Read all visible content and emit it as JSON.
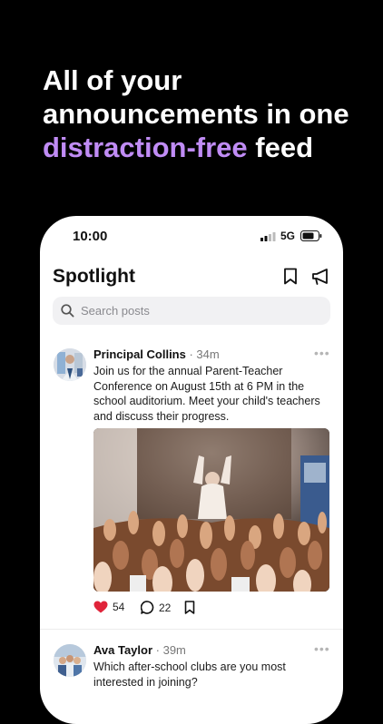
{
  "headline": {
    "line1": "All of your",
    "line2": "announcements in one",
    "accent": "distraction-free",
    "tail": " feed"
  },
  "status_bar": {
    "time": "10:00",
    "network": "5G"
  },
  "app": {
    "title": "Spotlight",
    "search_placeholder": "Search posts"
  },
  "posts": [
    {
      "author": "Principal Collins",
      "separator": " · ",
      "time": "34m",
      "body": "Join us for the annual Parent-Teacher Conference on August 15th at 6 PM in the school auditorium. Meet your child's teachers and discuss their progress.",
      "likes": "54",
      "comments": "22",
      "liked": true
    },
    {
      "author": "Ava Taylor",
      "separator": " · ",
      "time": "39m",
      "body": "Which after-school clubs are you most interested in joining?"
    }
  ],
  "colors": {
    "accent": "#c08cf5",
    "like": "#e0243a",
    "background": "#000000"
  }
}
